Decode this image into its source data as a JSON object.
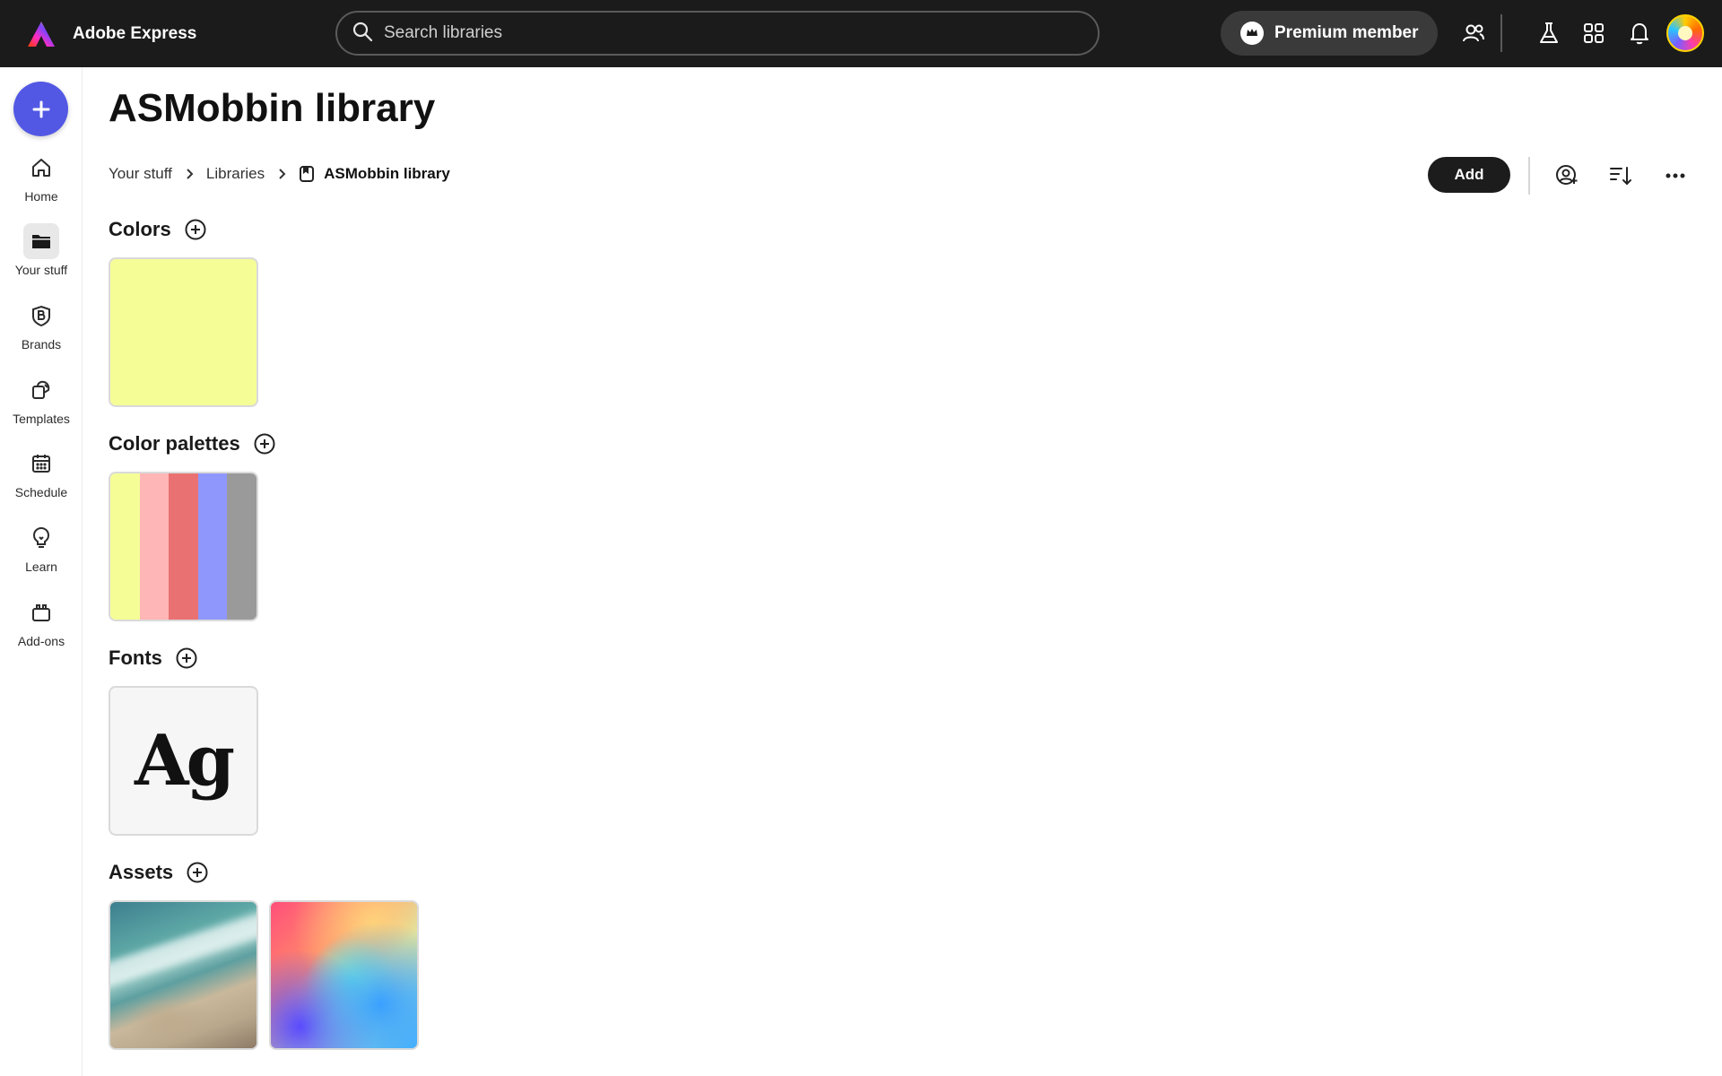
{
  "topbar": {
    "app_name": "Adobe Express",
    "search_placeholder": "Search libraries",
    "premium_label": "Premium member"
  },
  "rail": {
    "items": [
      {
        "label": "Home",
        "icon": "home-icon"
      },
      {
        "label": "Your stuff",
        "icon": "folder-icon",
        "active": true
      },
      {
        "label": "Brands",
        "icon": "brand-icon"
      },
      {
        "label": "Templates",
        "icon": "templates-icon"
      },
      {
        "label": "Schedule",
        "icon": "calendar-icon"
      },
      {
        "label": "Learn",
        "icon": "lightbulb-icon"
      },
      {
        "label": "Add-ons",
        "icon": "addons-icon"
      }
    ]
  },
  "page": {
    "title": "ASMobbin library",
    "breadcrumb": [
      "Your stuff",
      "Libraries",
      "ASMobbin library"
    ],
    "add_button": "Add"
  },
  "sections": {
    "colors": {
      "title": "Colors",
      "swatch": "#f5fd97"
    },
    "palettes": {
      "title": "Color palettes",
      "colors": [
        "#f5fd97",
        "#feb6b6",
        "#ea7171",
        "#8f97fd",
        "#9a9a9a"
      ]
    },
    "fonts": {
      "title": "Fonts",
      "sample": "Ag"
    },
    "assets": {
      "title": "Assets",
      "items": [
        "beach-aerial-photo",
        "gradient-image"
      ]
    }
  },
  "colors": {
    "topbar_bg": "#1b1b1b",
    "create_button": "#5258e4",
    "add_button_bg": "#1c1c1c"
  }
}
